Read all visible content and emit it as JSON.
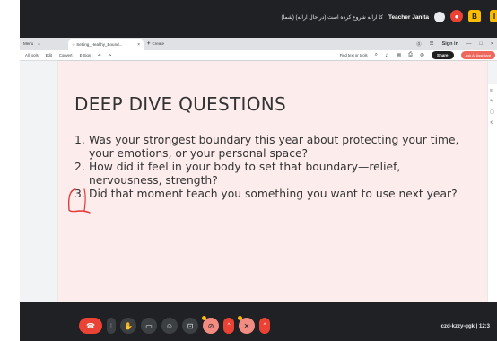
{
  "meet": {
    "presenter_subtitle": "(شما) کا ارائه شروع کرده است (در حال ارائه)",
    "presenter_name": "Teacher Janita",
    "meeting_code": "czd-kzzy-ggk",
    "time_fragment": "| 12:3",
    "top_btn_a": "B",
    "top_btn_b": "I"
  },
  "browser": {
    "menu": [
      "Menu",
      "⌂"
    ],
    "tab_title": "☆ Setting_Healthy_Bound...",
    "tab_close": "×",
    "new_tab_plus": "+",
    "new_tab_label": "Create",
    "sign_in": "Sign in",
    "window_controls": [
      "—",
      "□",
      "×"
    ]
  },
  "toolbar": {
    "left_items": [
      "All tools",
      "Edit",
      "Convert",
      "E-Sign",
      "↶",
      "↷"
    ],
    "find_text": "Find text or tools",
    "share": "Share",
    "ask_ai": "Ask AI Assistant"
  },
  "slide": {
    "title": "DEEP DIVE QUESTIONS",
    "questions": [
      {
        "num": "1.",
        "text": "Was your strongest boundary this year about protecting your time, your emotions, or your personal space?"
      },
      {
        "num": "2.",
        "text": "How did it feel in your body to set that boundary—relief, nervousness, strength?"
      },
      {
        "num": "3.",
        "text": "Did that moment teach you something you want to use next year?"
      }
    ],
    "cursor": "I"
  },
  "colors": {
    "meet_bg": "#202124",
    "page_bg": "#fdecec",
    "annotation": "#e53935",
    "end_call": "#ea4335"
  }
}
